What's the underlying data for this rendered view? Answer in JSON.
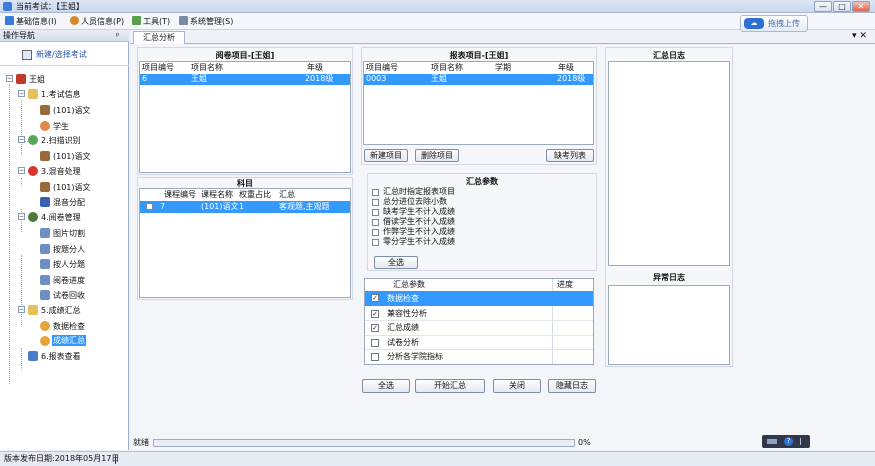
{
  "window": {
    "title": "当前考试：【王姐】",
    "min_label": "—",
    "max_label": "□",
    "close_label": "✕"
  },
  "menu": [
    {
      "label": "基础信息(I)",
      "color": "#3a7bd5"
    },
    {
      "label": "人员信息(P)",
      "color": "#d9882a"
    },
    {
      "label": "工具(T)",
      "color": "#5aa04a"
    },
    {
      "label": "系统管理(S)",
      "color": "#7a8aa6"
    }
  ],
  "upload": {
    "label": "拖拽上传",
    "icon_text": "☁"
  },
  "nav": {
    "title": "操作导航",
    "pin": "ᵖ",
    "new_exam": "新建/选择考试",
    "tree": {
      "root": "王姐",
      "n1": "1.考试信息",
      "n1a": "(101)语文",
      "n1b": "学生",
      "n2": "2.扫描识别",
      "n2a": "(101)语文",
      "n3": "3.混音处理",
      "n3a": "(101)语文",
      "n3b": "混音分配",
      "n4": "4.阅卷管理",
      "n4a": "图片切割",
      "n4b": "按题分人",
      "n4c": "按人分题",
      "n4d": "阅卷进度",
      "n4e": "试卷回收",
      "n5": "5.成绩汇总",
      "n5a": "数据检查",
      "n5b": "成绩汇总",
      "n6": "6.报表查看"
    }
  },
  "tabs": {
    "active": "汇总分析",
    "tools": "▾ ✕"
  },
  "grading": {
    "title": "阅卷项目-[王姐]",
    "headers": [
      "项目编号",
      "项目名称",
      "年级"
    ],
    "row": [
      "6",
      "王姐",
      "2018级"
    ]
  },
  "subjects": {
    "title": "科目",
    "headers": [
      "课程编号",
      "课程名称",
      "权重占比",
      "汇总"
    ],
    "row": [
      "7",
      "(101)语文",
      "1",
      "客观题,主观题"
    ]
  },
  "report": {
    "title": "报表项目-[王姐]",
    "headers": [
      "项目编号",
      "项目名称",
      "学期",
      "年级"
    ],
    "row": [
      "0003",
      "王姐",
      "",
      "2018级"
    ],
    "new_btn": "新建项目",
    "del_btn": "删除项目",
    "absent_btn": "缺考列表"
  },
  "params": {
    "title": "汇总参数",
    "options": [
      "汇总时指定报表项目",
      "总分进位去除小数",
      "缺考学生不计入成绩",
      "借读学生不计入成绩",
      "作弊学生不计入成绩",
      "零分学生不计入成绩"
    ],
    "select_all": "全选"
  },
  "steps": {
    "headers": [
      "汇总参数",
      "进度"
    ],
    "rows": [
      {
        "label": "数据检查",
        "checked": "✓"
      },
      {
        "label": "兼容性分析",
        "checked": "✓"
      },
      {
        "label": "汇总成绩",
        "checked": "✓"
      },
      {
        "label": "试卷分析",
        "checked": ""
      },
      {
        "label": "分析各学院指标",
        "checked": ""
      }
    ]
  },
  "actions": {
    "select_all": "全选",
    "start": "开始汇总",
    "close": "关闭",
    "hide_log": "隐藏日志"
  },
  "log": {
    "title": "汇总日志",
    "error_title": "异常日志"
  },
  "status": {
    "ready": "就绪",
    "percent": "0%",
    "progress": 0
  },
  "footer": {
    "release": "版本发布日期:2018年05月17日"
  },
  "tray": {
    "help": "?"
  }
}
